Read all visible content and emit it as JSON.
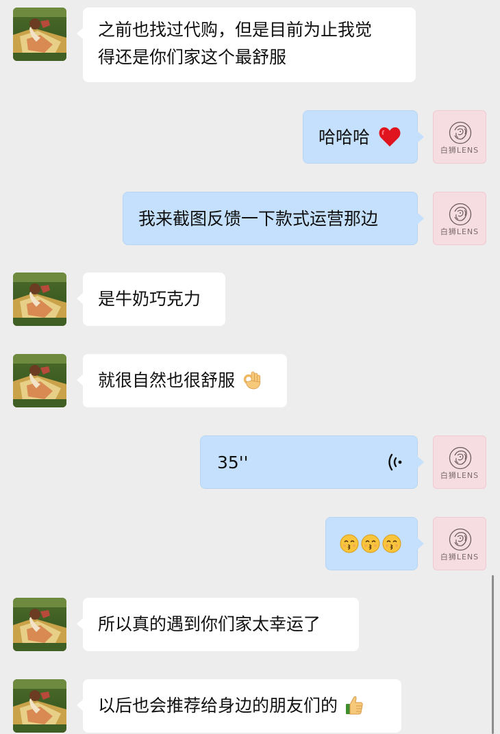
{
  "chat": {
    "shop_avatar_label": "白狮LENS",
    "messages": [
      {
        "side": "left",
        "text": "之前也找过代购，但是目前为止我觉",
        "text2": "得还是你们家这个最舒服"
      },
      {
        "side": "right",
        "text": "哈哈哈"
      },
      {
        "side": "right",
        "text": "我来截图反馈一下款式运营那边"
      },
      {
        "side": "left",
        "text": "是牛奶巧克力"
      },
      {
        "side": "left",
        "text": "就很自然也很舒服"
      },
      {
        "side": "right",
        "type": "voice",
        "duration": "35''"
      },
      {
        "side": "right",
        "type": "emoji-only"
      },
      {
        "side": "left",
        "text": "所以真的遇到你们家太幸运了"
      },
      {
        "side": "left",
        "text": "以后也会推荐给身边的朋友们的"
      }
    ]
  },
  "icons": {
    "heart": "red-heart-icon",
    "ok": "ok-hand-icon",
    "kiss": "kissing-face-icon",
    "thumb": "thumbs-up-icon",
    "voice": "voice-wave-icon"
  },
  "colors": {
    "background": "#ededed",
    "bubble_left": "#ffffff",
    "bubble_right": "#c5e0fc",
    "shop_avatar_bg": "#f6dde2"
  }
}
